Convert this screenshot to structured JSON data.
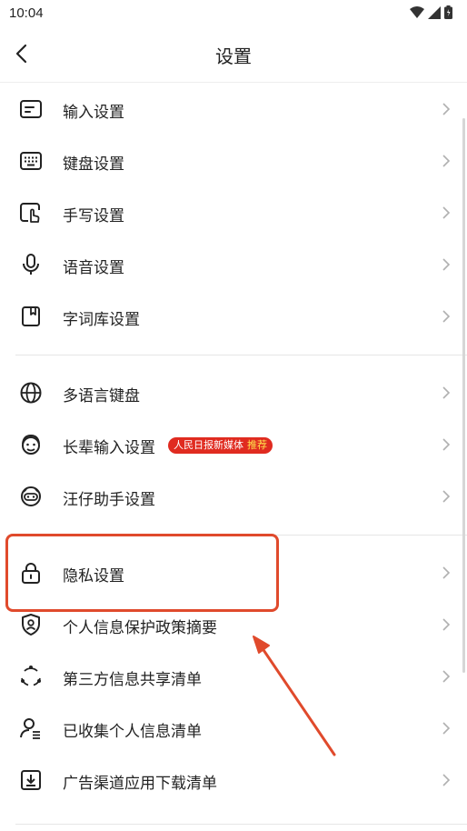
{
  "status_bar": {
    "time": "10:04",
    "icons": [
      "wifi-icon",
      "signal-icon",
      "battery-icon"
    ]
  },
  "header": {
    "title": "设置",
    "back_icon": "chevron-left-icon"
  },
  "groups": [
    {
      "items": [
        {
          "label": "输入设置",
          "icon": "input-box-icon"
        },
        {
          "label": "键盘设置",
          "icon": "keyboard-icon"
        },
        {
          "label": "手写设置",
          "icon": "handwriting-icon"
        },
        {
          "label": "语音设置",
          "icon": "microphone-icon"
        },
        {
          "label": "字词库设置",
          "icon": "dictionary-icon"
        }
      ]
    },
    {
      "items": [
        {
          "label": "多语言键盘",
          "icon": "globe-icon"
        },
        {
          "label": "长辈输入设置",
          "icon": "elder-face-icon",
          "badge": {
            "text": "人民日报新媒体",
            "tag": "推荐"
          }
        },
        {
          "label": "汪仔助手设置",
          "icon": "mascot-icon"
        }
      ]
    },
    {
      "items": [
        {
          "label": "隐私设置",
          "icon": "lock-icon"
        },
        {
          "label": "个人信息保护政策摘要",
          "icon": "shield-person-icon"
        },
        {
          "label": "第三方信息共享清单",
          "icon": "share-circle-icon"
        },
        {
          "label": "已收集个人信息清单",
          "icon": "person-list-icon"
        },
        {
          "label": "广告渠道应用下载清单",
          "icon": "download-icon"
        }
      ]
    }
  ],
  "colors": {
    "accent_red": "#e04a2c",
    "badge_red": "#e02b20",
    "badge_tag": "#ffe34d",
    "text": "#222222",
    "chevron": "#b0b0b0"
  },
  "annotation": {
    "highlight_target": "隐私设置",
    "shapes": [
      "highlight-box",
      "arrow"
    ]
  }
}
